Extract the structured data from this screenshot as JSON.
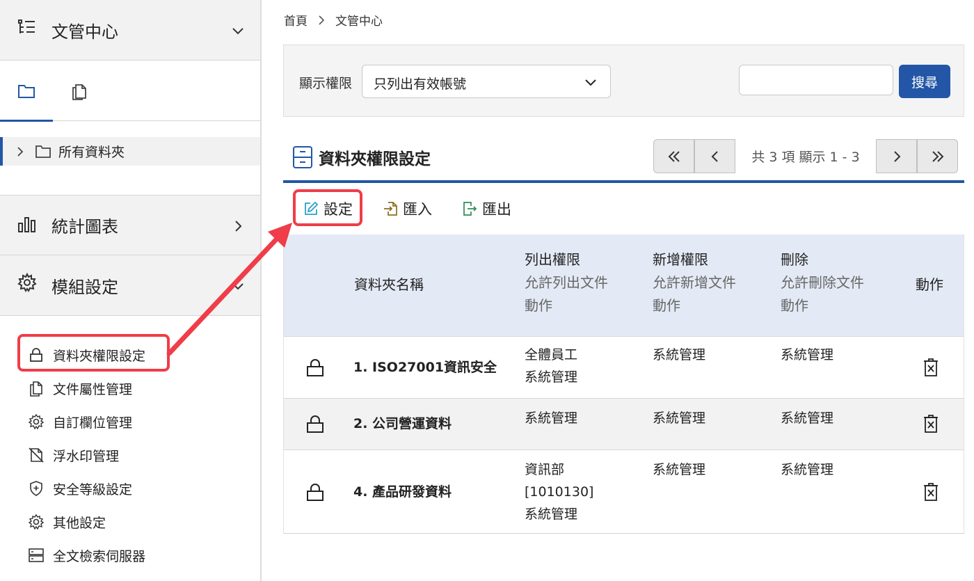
{
  "sidebar": {
    "doc_center_title": "文管中心",
    "tree_root_label": "所有資料夾",
    "stats_title": "統計圖表",
    "module_title": "模組設定",
    "menu": [
      {
        "label": "資料夾權限設定",
        "icon": "lock-icon"
      },
      {
        "label": "文件屬性管理",
        "icon": "documents-icon"
      },
      {
        "label": "自訂欄位管理",
        "icon": "gear-icon"
      },
      {
        "label": "浮水印管理",
        "icon": "watermark-icon"
      },
      {
        "label": "安全等級設定",
        "icon": "shield-icon"
      },
      {
        "label": "其他設定",
        "icon": "gear-icon"
      },
      {
        "label": "全文檢索伺服器",
        "icon": "server-icon"
      }
    ]
  },
  "breadcrumb": {
    "home": "首頁",
    "current": "文管中心"
  },
  "filter": {
    "label": "顯示權限",
    "selected": "只列出有效帳號",
    "search_value": "",
    "search_button": "搜尋"
  },
  "section": {
    "title": "資料夾權限設定"
  },
  "pager": {
    "info": "共 3 項 顯示 1 - 3"
  },
  "toolbar": {
    "set_label": "設定",
    "import_label": "匯入",
    "export_label": "匯出"
  },
  "table": {
    "headers": {
      "name": "資料夾名稱",
      "list_title": "列出權限",
      "list_sub1": "允許列出文件",
      "list_sub2": "動作",
      "add_title": "新增權限",
      "add_sub1": "允許新增文件",
      "add_sub2": "動作",
      "del_title": "刪除",
      "del_sub1": "允許刪除文件",
      "del_sub2": "動作",
      "action": "動作"
    },
    "rows": [
      {
        "name": "1. ISO27001資訊安全",
        "list": [
          "全體員工",
          "系統管理"
        ],
        "add": "系統管理",
        "del": "系統管理"
      },
      {
        "name": "2. 公司營運資料",
        "list": [
          "系統管理"
        ],
        "add": "系統管理",
        "del": "系統管理"
      },
      {
        "name": "4. 產品研發資料",
        "list": [
          "資訊部",
          "[1010130]",
          "系統管理"
        ],
        "add": "系統管理",
        "del": "系統管理"
      }
    ]
  },
  "colors": {
    "accent": "#2356a6",
    "highlight": "#ef3d49",
    "header_bg": "#e3eaf5"
  }
}
